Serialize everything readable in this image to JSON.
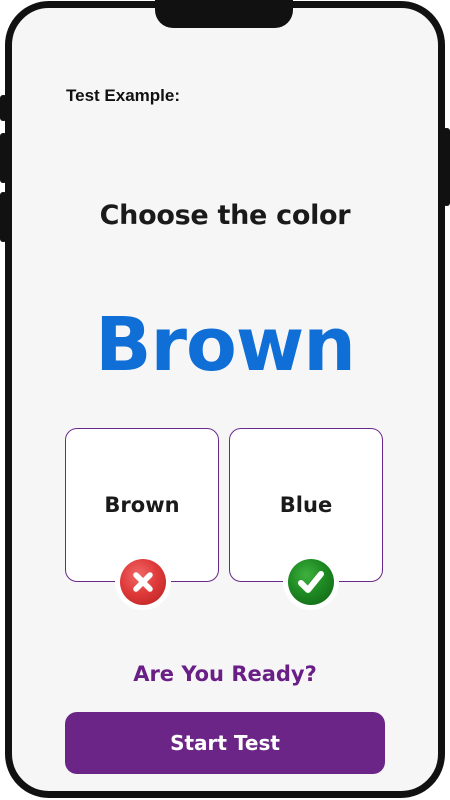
{
  "header": {
    "label": "Test Example:"
  },
  "prompt": {
    "title": "Choose the color",
    "word": "Brown",
    "word_color": "#0f6fd6"
  },
  "options": [
    {
      "label": "Brown",
      "result": "wrong",
      "icon": "x-mark-icon",
      "badge_color": "#e03b3b"
    },
    {
      "label": "Blue",
      "result": "correct",
      "icon": "check-mark-icon",
      "badge_color": "#1e8a22"
    }
  ],
  "footer": {
    "ready_text": "Are You Ready?",
    "start_label": "Start Test",
    "accent_color": "#6b2586"
  }
}
